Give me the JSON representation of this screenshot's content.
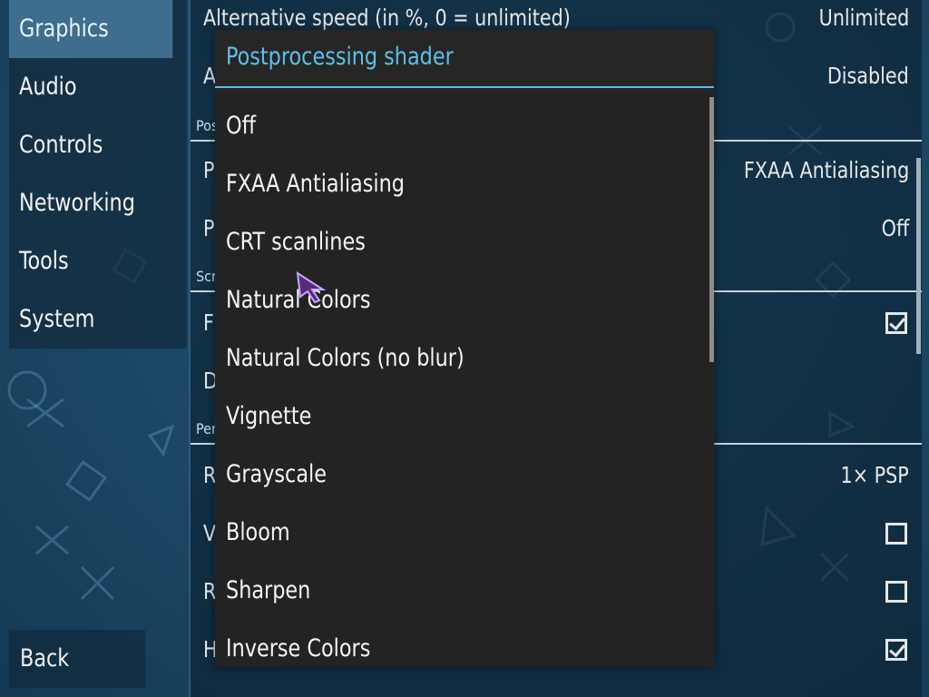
{
  "nav": {
    "items": [
      {
        "label": "Graphics",
        "active": true
      },
      {
        "label": "Audio"
      },
      {
        "label": "Controls"
      },
      {
        "label": "Networking"
      },
      {
        "label": "Tools"
      },
      {
        "label": "System"
      }
    ],
    "back_label": "Back"
  },
  "settings": {
    "row_alt_speed": {
      "label": "Alternative speed (in %, 0 = unlimited)",
      "value": "Unlimited"
    },
    "row_alt_speed2": {
      "label": "A",
      "value": "Disabled"
    },
    "header_postprocessing": "Pos",
    "row_postprocessing_shader": {
      "label": "P",
      "value": "FXAA Antialiasing"
    },
    "row_postprocessing_2": {
      "label": "P",
      "value": "Off"
    },
    "header_screen": "Scr",
    "row_screen_f": {
      "label": "F",
      "checked": true
    },
    "row_screen_d": {
      "label": "D"
    },
    "header_performance": "Per",
    "row_rendering": {
      "label": "R",
      "value": "1× PSP"
    },
    "row_vsync": {
      "label": "V",
      "checked": false
    },
    "row_r2": {
      "label": "R",
      "checked": false
    },
    "row_h": {
      "label": "H",
      "checked": true
    }
  },
  "dialog": {
    "title": "Postprocessing shader",
    "options": [
      "Off",
      "FXAA Antialiasing",
      "CRT scanlines",
      "Natural Colors",
      "Natural Colors (no blur)",
      "Vignette",
      "Grayscale",
      "Bloom",
      "Sharpen",
      "Inverse Colors"
    ]
  },
  "colors": {
    "accent": "#59c1ea",
    "dialog_bg": "#232323",
    "nav_active": "#3e6d8e"
  }
}
